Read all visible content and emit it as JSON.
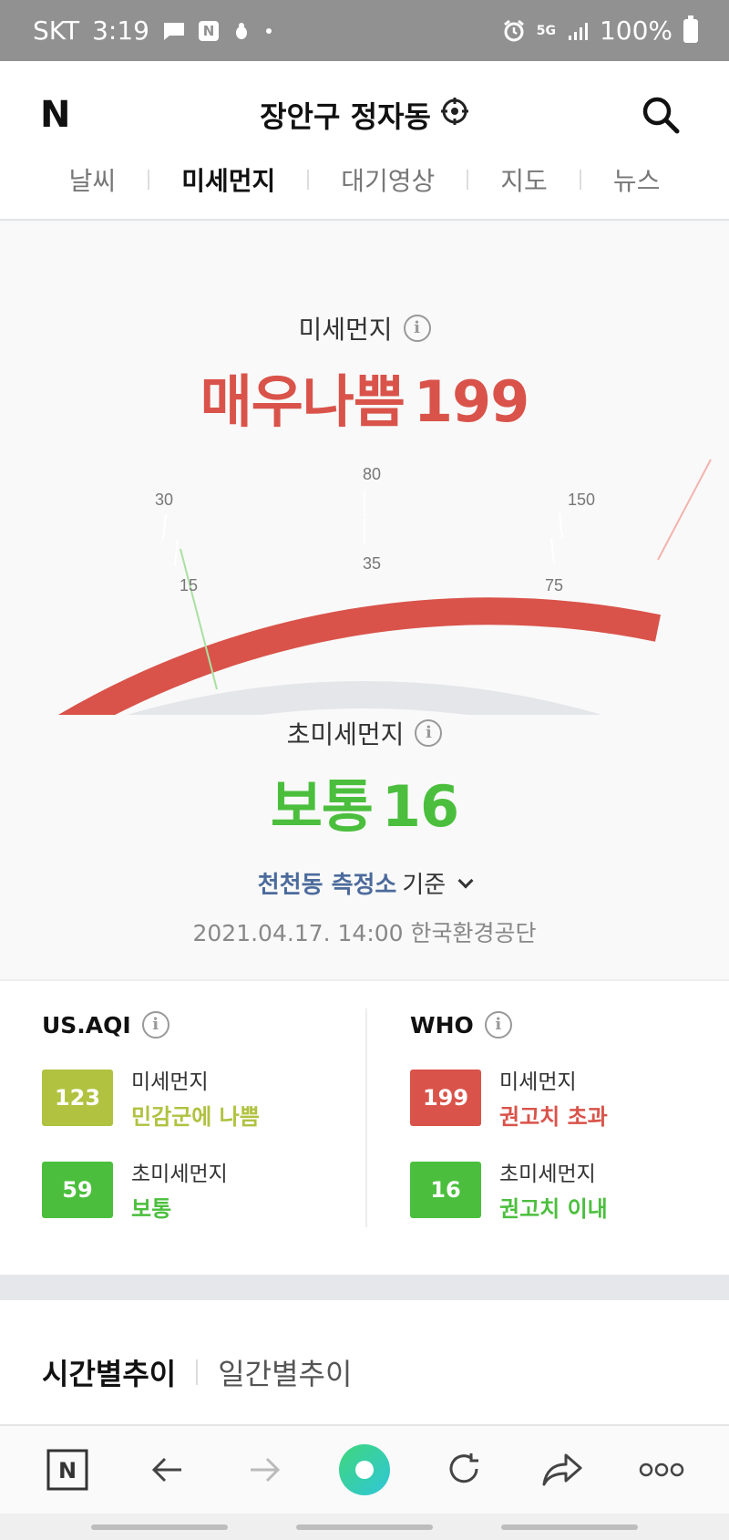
{
  "status_bar": {
    "carrier": "SKT",
    "time": "3:19",
    "battery": "100%",
    "network": "5G"
  },
  "header": {
    "logo": "N",
    "location": "장안구 정자동",
    "tabs": [
      {
        "label": "날씨"
      },
      {
        "label": "미세먼지"
      },
      {
        "label": "대기영상"
      },
      {
        "label": "지도"
      },
      {
        "label": "뉴스"
      }
    ]
  },
  "gauge": {
    "pm10_label": "미세먼지",
    "pm10_status": "매우나쁨",
    "pm10_value": "199",
    "pm25_label": "초미세먼지",
    "pm25_status": "보통",
    "pm25_value": "16",
    "outer_ticks": [
      "30",
      "80",
      "150"
    ],
    "inner_ticks": [
      "15",
      "35",
      "75"
    ],
    "pm10_level": 199,
    "pm25_level": 16,
    "colors": {
      "bad": "#d9534a",
      "good": "#4bbf3d",
      "track": "#e4e6e9"
    }
  },
  "station": {
    "name": "천천동 측정소",
    "suffix": "기준",
    "timestamp": "2021.04.17. 14:00 한국환경공단"
  },
  "indices": {
    "usaqi": {
      "title": "US.AQI",
      "rows": [
        {
          "value": "123",
          "name": "미세먼지",
          "status": "민감군에 나쁨",
          "color": "#b0c23f"
        },
        {
          "value": "59",
          "name": "초미세먼지",
          "status": "보통",
          "color": "#4bbf3d"
        }
      ]
    },
    "who": {
      "title": "WHO",
      "rows": [
        {
          "value": "199",
          "name": "미세먼지",
          "status": "권고치 초과",
          "color": "#d9534a"
        },
        {
          "value": "16",
          "name": "초미세먼지",
          "status": "권고치 이내",
          "color": "#4bbf3d"
        }
      ]
    }
  },
  "trend": {
    "tabs": [
      {
        "label": "시간별추이"
      },
      {
        "label": "일간별추이"
      }
    ]
  },
  "browser_bar": {
    "icons": [
      "naver-home-icon",
      "back-arrow-icon",
      "forward-arrow-icon",
      "green-dot-icon",
      "refresh-icon",
      "share-icon",
      "more-icon"
    ]
  }
}
